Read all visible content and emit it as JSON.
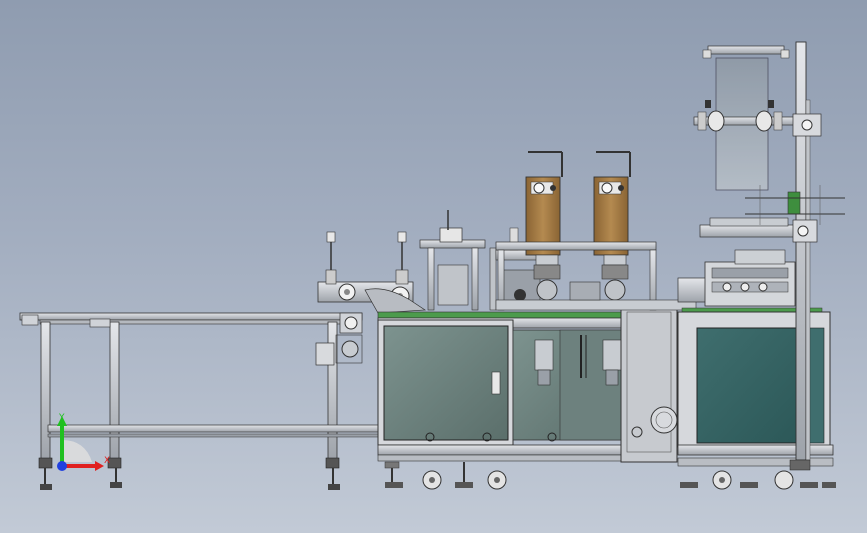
{
  "viewport": {
    "background_top": "#8f9cb0",
    "background_bottom": "#c2cad6"
  },
  "model": {
    "description_hidden": "",
    "frame_color": "#c9ccd0",
    "panel_color": "#4f6f6a",
    "ultrasonic_color": "#a07840"
  },
  "triad": {
    "x_label": "X",
    "y_label": "Y",
    "x_color": "#e02020",
    "y_color": "#20c020",
    "z_color": "#2040e0"
  }
}
